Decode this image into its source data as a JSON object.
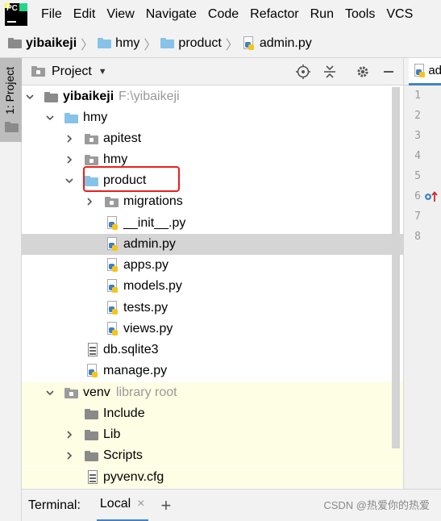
{
  "menu": {
    "items": [
      "File",
      "Edit",
      "View",
      "Navigate",
      "Code",
      "Refactor",
      "Run",
      "Tools",
      "VCS"
    ]
  },
  "breadcrumb": {
    "items": [
      {
        "label": "yibaikeji",
        "icon": "folder-icon"
      },
      {
        "label": "hmy",
        "icon": "folder-icon"
      },
      {
        "label": "product",
        "icon": "folder-icon"
      },
      {
        "label": "admin.py",
        "icon": "python-file-icon"
      }
    ]
  },
  "sidebar": {
    "project_tab_label": "1: Project"
  },
  "panel": {
    "title": "Project"
  },
  "editor": {
    "tab_label": "ad",
    "line_numbers": [
      "1",
      "2",
      "3",
      "4",
      "5",
      "6",
      "7",
      "8"
    ]
  },
  "tree": {
    "root_label": "yibaikeji",
    "root_path": "F:\\yibaikeji",
    "hmy": "hmy",
    "apitest": "apitest",
    "hmy_sub": "hmy",
    "product": "product",
    "migrations": "migrations",
    "init_py": "__init__.py",
    "admin_py": "admin.py",
    "apps_py": "apps.py",
    "models_py": "models.py",
    "tests_py": "tests.py",
    "views_py": "views.py",
    "db_sqlite3": "db.sqlite3",
    "manage_py": "manage.py",
    "venv": "venv",
    "venv_hint": "library root",
    "include": "Include",
    "lib": "Lib",
    "scripts": "Scripts",
    "pyvenv_cfg": "pyvenv.cfg"
  },
  "terminal": {
    "label": "Terminal:",
    "tab_label": "Local",
    "close_symbol": "×",
    "add_symbol": "+"
  },
  "watermark": "CSDN @热爱你的热爱",
  "colors": {
    "selection": "#d5d5d5",
    "library_bg": "#fefee4",
    "highlight_box": "#e8201d",
    "folder_blue": "#87c3e8"
  }
}
